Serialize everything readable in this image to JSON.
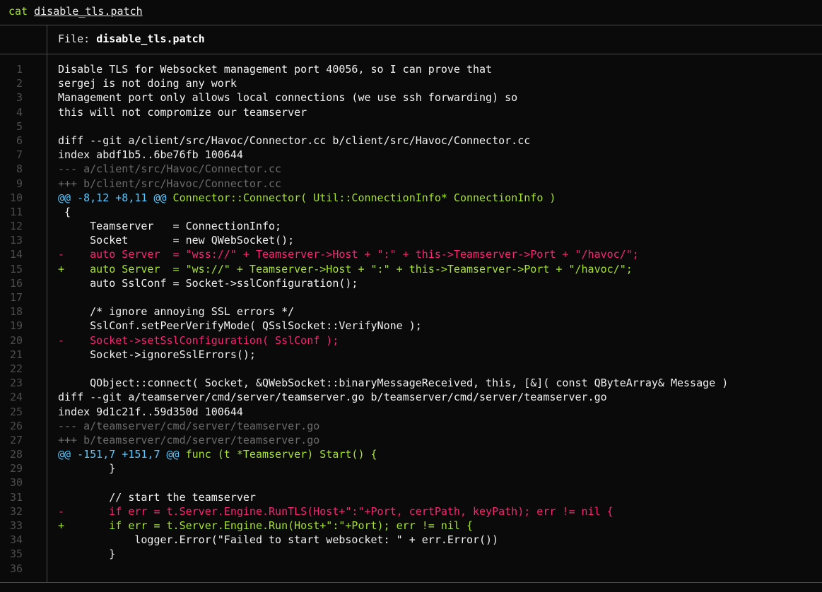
{
  "terminal": {
    "command": "cat",
    "argument": "disable_tls.patch"
  },
  "viewer": {
    "file_label": "File: ",
    "file_name": "disable_tls.patch"
  },
  "colors": {
    "background": "#0a0a0a",
    "removed_line": "#f92672",
    "added_line": "#a6e22e",
    "hunk_header": "#57c7ff",
    "file_header": "#6b6b6b",
    "line_number": "#4d4d4d"
  },
  "lines": [
    {
      "n": "1",
      "kind": "plain",
      "text": "Disable TLS for Websocket management port 40056, so I can prove that"
    },
    {
      "n": "2",
      "kind": "plain",
      "text": "sergej is not doing any work"
    },
    {
      "n": "3",
      "kind": "plain",
      "text": "Management port only allows local connections (we use ssh forwarding) so"
    },
    {
      "n": "4",
      "kind": "plain",
      "text": "this will not compromize our teamserver"
    },
    {
      "n": "5",
      "kind": "plain",
      "text": ""
    },
    {
      "n": "6",
      "kind": "plain",
      "text": "diff --git a/client/src/Havoc/Connector.cc b/client/src/Havoc/Connector.cc"
    },
    {
      "n": "7",
      "kind": "plain",
      "text": "index abdf1b5..6be76fb 100644"
    },
    {
      "n": "8",
      "kind": "meta",
      "text": "--- a/client/src/Havoc/Connector.cc"
    },
    {
      "n": "9",
      "kind": "meta",
      "text": "+++ b/client/src/Havoc/Connector.cc"
    },
    {
      "n": "10",
      "kind": "hunk",
      "text": "@@ -8,12 +8,11 @@",
      "ctx": " Connector::Connector( Util::ConnectionInfo* ConnectionInfo )"
    },
    {
      "n": "11",
      "kind": "plain",
      "text": " {"
    },
    {
      "n": "12",
      "kind": "plain",
      "text": "     Teamserver   = ConnectionInfo;"
    },
    {
      "n": "13",
      "kind": "plain",
      "text": "     Socket       = new QWebSocket();"
    },
    {
      "n": "14",
      "kind": "del",
      "text": "     auto Server  = \"wss://\" + Teamserver->Host + \":\" + this->Teamserver->Port + \"/havoc/\";"
    },
    {
      "n": "15",
      "kind": "add",
      "text": "     auto Server  = \"ws://\" + Teamserver->Host + \":\" + this->Teamserver->Port + \"/havoc/\";"
    },
    {
      "n": "16",
      "kind": "plain",
      "text": "     auto SslConf = Socket->sslConfiguration();"
    },
    {
      "n": "17",
      "kind": "plain",
      "text": ""
    },
    {
      "n": "18",
      "kind": "plain",
      "text": "     /* ignore annoying SSL errors */"
    },
    {
      "n": "19",
      "kind": "plain",
      "text": "     SslConf.setPeerVerifyMode( QSslSocket::VerifyNone );"
    },
    {
      "n": "20",
      "kind": "del",
      "text": "     Socket->setSslConfiguration( SslConf );"
    },
    {
      "n": "21",
      "kind": "plain",
      "text": "     Socket->ignoreSslErrors();"
    },
    {
      "n": "22",
      "kind": "plain",
      "text": ""
    },
    {
      "n": "23",
      "kind": "plain",
      "text": "     QObject::connect( Socket, &QWebSocket::binaryMessageReceived, this, [&]( const QByteArray& Message )"
    },
    {
      "n": "24",
      "kind": "plain",
      "text": "diff --git a/teamserver/cmd/server/teamserver.go b/teamserver/cmd/server/teamserver.go"
    },
    {
      "n": "25",
      "kind": "plain",
      "text": "index 9d1c21f..59d350d 100644"
    },
    {
      "n": "26",
      "kind": "meta",
      "text": "--- a/teamserver/cmd/server/teamserver.go"
    },
    {
      "n": "27",
      "kind": "meta",
      "text": "+++ b/teamserver/cmd/server/teamserver.go"
    },
    {
      "n": "28",
      "kind": "hunk",
      "text": "@@ -151,7 +151,7 @@",
      "ctx": " func (t *Teamserver) Start() {"
    },
    {
      "n": "29",
      "kind": "plain",
      "text": "        }"
    },
    {
      "n": "30",
      "kind": "plain",
      "text": ""
    },
    {
      "n": "31",
      "kind": "plain",
      "text": "        // start the teamserver"
    },
    {
      "n": "32",
      "kind": "del",
      "text": "        if err = t.Server.Engine.RunTLS(Host+\":\"+Port, certPath, keyPath); err != nil {"
    },
    {
      "n": "33",
      "kind": "add",
      "text": "        if err = t.Server.Engine.Run(Host+\":\"+Port); err != nil {"
    },
    {
      "n": "34",
      "kind": "plain",
      "text": "            logger.Error(\"Failed to start websocket: \" + err.Error())"
    },
    {
      "n": "35",
      "kind": "plain",
      "text": "        }"
    },
    {
      "n": "36",
      "kind": "plain",
      "text": ""
    }
  ]
}
